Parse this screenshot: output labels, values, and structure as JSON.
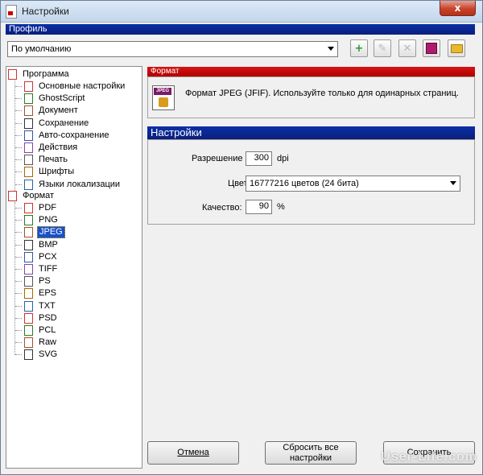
{
  "window": {
    "title": "Настройки",
    "close_glyph": "x"
  },
  "profile": {
    "header": "Профиль",
    "selected": "По умолчанию"
  },
  "toolbar": [
    {
      "name": "add-profile-button",
      "glyph": "+",
      "color": "#2a9d2a"
    },
    {
      "name": "rename-profile-button",
      "glyph": "✎",
      "color": "#b9b9b9"
    },
    {
      "name": "delete-profile-button",
      "glyph": "✕",
      "color": "#b9b9b9"
    },
    {
      "name": "save-profile-button",
      "glyph": "■",
      "color": "#b01a6e"
    },
    {
      "name": "open-profile-button",
      "glyph": "▬",
      "color": "#e8b92c"
    }
  ],
  "tree": {
    "program": {
      "label": "Программа",
      "children": [
        "Основные настройки",
        "GhostScript",
        "Документ",
        "Сохранение",
        "Авто-сохранение",
        "Действия",
        "Печать",
        "Шрифты",
        "Языки локализации"
      ]
    },
    "format": {
      "label": "Формат",
      "children": [
        "PDF",
        "PNG",
        "JPEG",
        "BMP",
        "PCX",
        "TIFF",
        "PS",
        "EPS",
        "TXT",
        "PSD",
        "PCL",
        "Raw",
        "SVG"
      ],
      "selected": "JPEG"
    }
  },
  "format_section": {
    "header": "Формат",
    "icon_text": "JPEG",
    "description": "Формат JPEG (JFIF). Используйте только для одинарных страниц."
  },
  "settings": {
    "header": "Настройки",
    "resolution_label": "Разрешение",
    "resolution_value": "300",
    "resolution_unit": "dpi",
    "colors_label": "Цвета",
    "colors_value": "16777216 цветов (24 бита)",
    "quality_label": "Качество:",
    "quality_value": "90",
    "quality_unit": "%"
  },
  "buttons": {
    "cancel": "Отмена",
    "reset_line1": "Сбросить все",
    "reset_line2": "настройки",
    "save": "Сохранить"
  },
  "watermark": "User-Life.com",
  "colors": {
    "blue_header": "#0a2fa8",
    "red_header": "#c00000",
    "selection": "#1a50c8"
  }
}
